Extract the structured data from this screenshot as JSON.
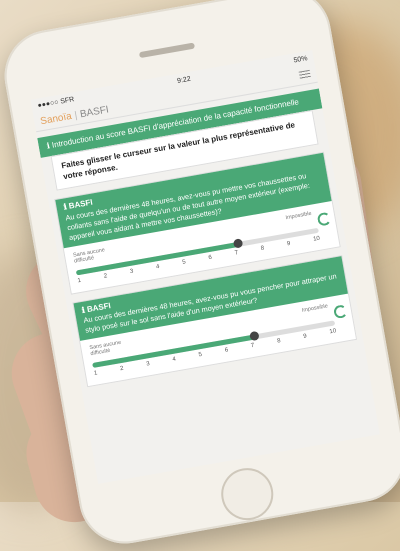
{
  "screen": {
    "status": {
      "carrier": "●●●○○ SFR",
      "time": "9:22",
      "battery": "50%"
    },
    "app": {
      "name": "Sanoïa",
      "section": "BASFI"
    },
    "intro": "Introduction au score BASFI d'appréciation de la capacité fonctionnelle",
    "instruction": "Faites glisser le curseur sur la valeur la plus représentative de votre réponse.",
    "questions": [
      {
        "title": "BASFI",
        "text": "Au cours des dernières 48 heures, avez-vous pu mettre vos chaussettes ou collants sans l'aide de quelqu'un ou de tout autre moyen extérieur (exemple: appareil vous aidant à mettre vos chaussettes)?",
        "min_label": "Sans aucune difficulté",
        "max_label": "Impossible",
        "ticks": [
          "1",
          "2",
          "3",
          "4",
          "5",
          "6",
          "7",
          "8",
          "9",
          "10"
        ],
        "value": 7
      },
      {
        "title": "BASFI",
        "text": "Au cours des dernières 48 heures, avez-vous pu vous pencher pour attraper un stylo posé sur le sol sans l'aide d'un moyen extérieur?",
        "min_label": "Sans aucune difficulté",
        "max_label": "Impossible",
        "ticks": [
          "1",
          "2",
          "3",
          "4",
          "5",
          "6",
          "7",
          "8",
          "9",
          "10"
        ],
        "value": 7
      }
    ]
  }
}
